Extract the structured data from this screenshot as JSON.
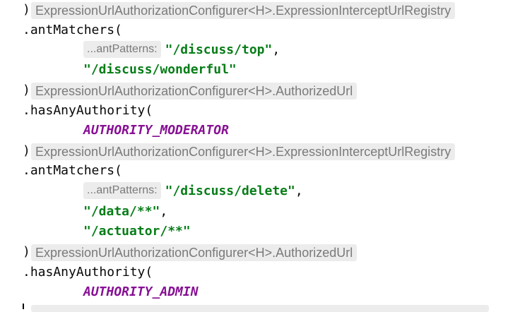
{
  "editor": {
    "hints": [
      {
        "paren": ")",
        "text": "ExpressionUrlAuthorizationConfigurer<H>.ExpressionInterceptUrlRegistry"
      },
      {
        "paren": ")",
        "text": "ExpressionUrlAuthorizationConfigurer<H>.AuthorizedUrl"
      },
      {
        "paren": ")",
        "text": "ExpressionUrlAuthorizationConfigurer<H>.ExpressionInterceptUrlRegistry"
      },
      {
        "paren": ")",
        "text": "ExpressionUrlAuthorizationConfigurer<H>.AuthorizedUrl"
      }
    ],
    "calls": [
      {
        "method": ".antMatchers("
      },
      {
        "method": ".hasAnyAuthority("
      },
      {
        "method": ".antMatchers("
      },
      {
        "method": ".hasAnyAuthority("
      }
    ],
    "param_hint": "...antPatterns:",
    "args": {
      "a1": "\"/discuss/top\"",
      "a2": "\"/discuss/wonderful\"",
      "a3": "AUTHORITY_MODERATOR",
      "a4": "\"/discuss/delete\"",
      "a5": "\"/data/**\"",
      "a6": "\"/actuator/**\"",
      "a7": "AUTHORITY_ADMIN"
    },
    "comma": ","
  }
}
